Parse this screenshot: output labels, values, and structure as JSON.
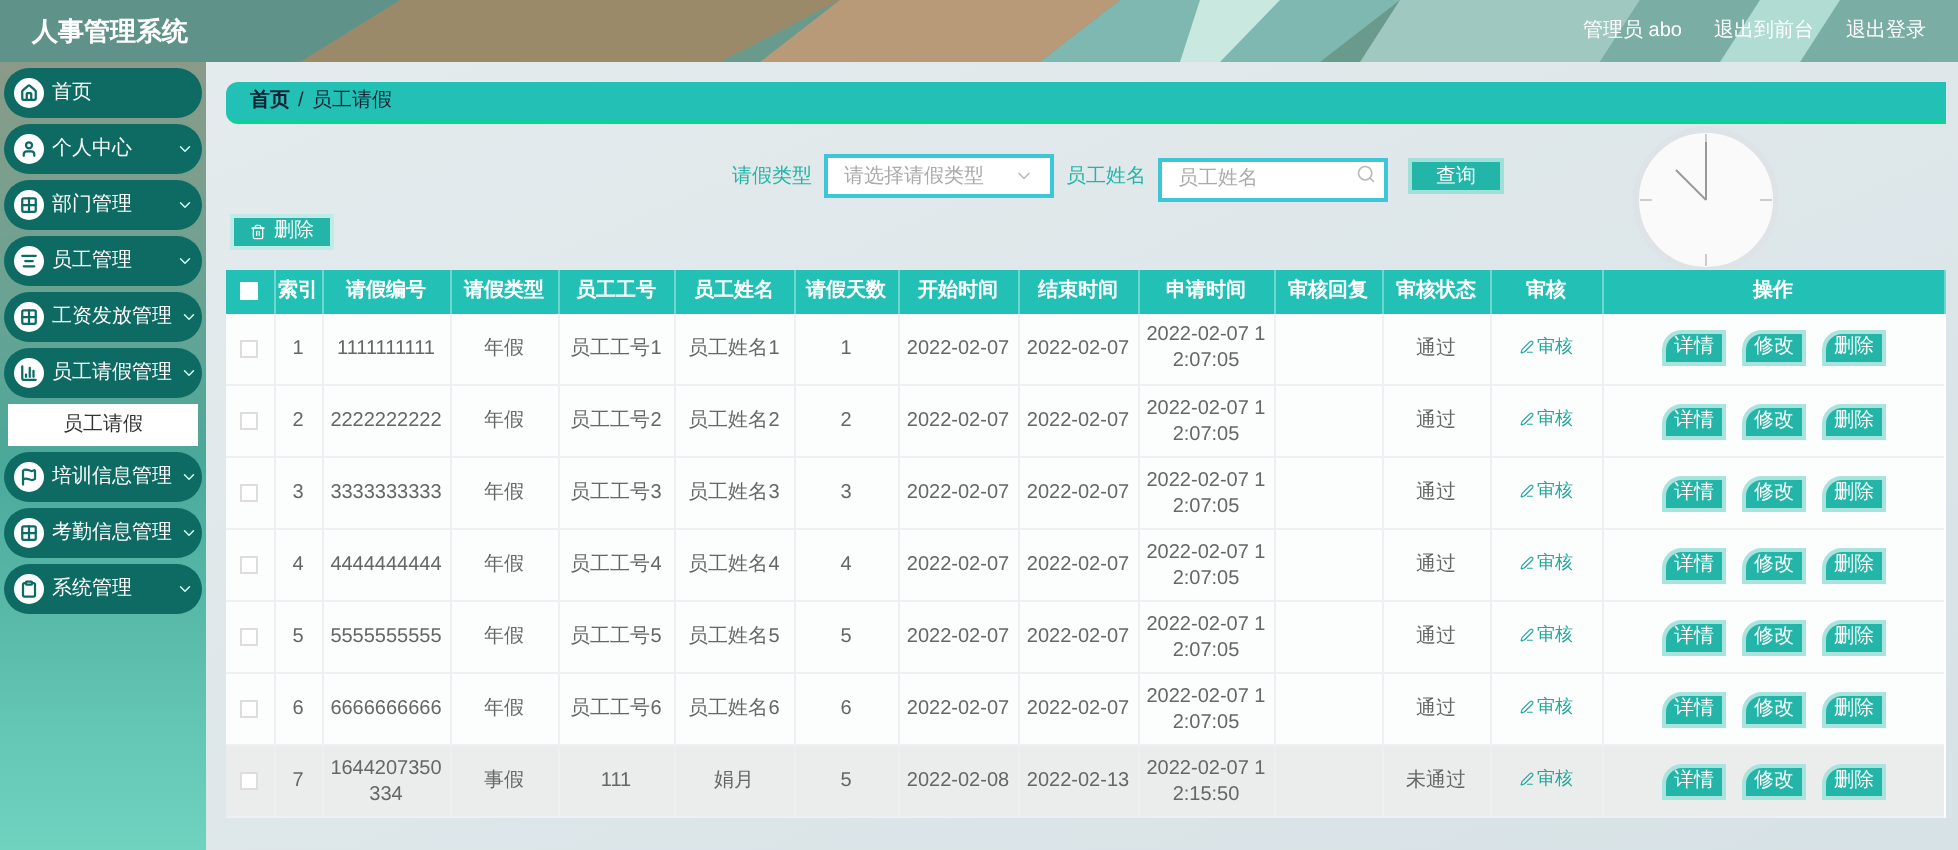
{
  "header": {
    "title": "人事管理系统",
    "links": [
      "管理员 abo",
      "退出到前台",
      "退出登录"
    ]
  },
  "sidebar": {
    "items": [
      {
        "label": "首页",
        "has_arrow": false
      },
      {
        "label": "个人中心",
        "has_arrow": true
      },
      {
        "label": "部门管理",
        "has_arrow": true
      },
      {
        "label": "员工管理",
        "has_arrow": true
      },
      {
        "label": "工资发放管理",
        "has_arrow": true
      },
      {
        "label": "员工请假管理",
        "has_arrow": true,
        "children": [
          {
            "label": "员工请假",
            "selected": true
          }
        ]
      },
      {
        "label": "培训信息管理",
        "has_arrow": true
      },
      {
        "label": "考勤信息管理",
        "has_arrow": true
      },
      {
        "label": "系统管理",
        "has_arrow": true
      }
    ]
  },
  "breadcrumb": [
    "首页",
    "/",
    "员工请假"
  ],
  "search": {
    "type_label": "请假类型",
    "type_placeholder": "请选择请假类型",
    "name_label": "员工姓名",
    "name_placeholder": "员工姓名",
    "button": "查询"
  },
  "delete_button": "删除",
  "table": {
    "select_all_checked": false,
    "columns": [
      "索引",
      "请假编号",
      "请假类型",
      "员工工号",
      "员工姓名",
      "请假天数",
      "开始时间",
      "结束时间",
      "申请时间",
      "审核回复",
      "审核状态",
      "审核",
      "操作"
    ],
    "rows": [
      {
        "checked": false,
        "highlighted": false,
        "cells": [
          "1",
          "1111111111",
          "年假",
          "员工工号1",
          "员工姓名1",
          "1",
          "2022-02-07",
          "2022-02-07",
          "2022-02-07 12:07:05",
          "",
          "通过"
        ],
        "review": "审核",
        "actions": [
          "详情",
          "修改",
          "删除"
        ]
      },
      {
        "checked": false,
        "highlighted": false,
        "cells": [
          "2",
          "2222222222",
          "年假",
          "员工工号2",
          "员工姓名2",
          "2",
          "2022-02-07",
          "2022-02-07",
          "2022-02-07 12:07:05",
          "",
          "通过"
        ],
        "review": "审核",
        "actions": [
          "详情",
          "修改",
          "删除"
        ]
      },
      {
        "checked": false,
        "highlighted": false,
        "cells": [
          "3",
          "3333333333",
          "年假",
          "员工工号3",
          "员工姓名3",
          "3",
          "2022-02-07",
          "2022-02-07",
          "2022-02-07 12:07:05",
          "",
          "通过"
        ],
        "review": "审核",
        "actions": [
          "详情",
          "修改",
          "删除"
        ]
      },
      {
        "checked": false,
        "highlighted": false,
        "cells": [
          "4",
          "4444444444",
          "年假",
          "员工工号4",
          "员工姓名4",
          "4",
          "2022-02-07",
          "2022-02-07",
          "2022-02-07 12:07:05",
          "",
          "通过"
        ],
        "review": "审核",
        "actions": [
          "详情",
          "修改",
          "删除"
        ]
      },
      {
        "checked": false,
        "highlighted": false,
        "cells": [
          "5",
          "5555555555",
          "年假",
          "员工工号5",
          "员工姓名5",
          "5",
          "2022-02-07",
          "2022-02-07",
          "2022-02-07 12:07:05",
          "",
          "通过"
        ],
        "review": "审核",
        "actions": [
          "详情",
          "修改",
          "删除"
        ]
      },
      {
        "checked": false,
        "highlighted": false,
        "cells": [
          "6",
          "6666666666",
          "年假",
          "员工工号6",
          "员工姓名6",
          "6",
          "2022-02-07",
          "2022-02-07",
          "2022-02-07 12:07:05",
          "",
          "通过"
        ],
        "review": "审核",
        "actions": [
          "详情",
          "修改",
          "删除"
        ]
      },
      {
        "checked": false,
        "highlighted": true,
        "cells": [
          "7",
          "1644207350334",
          "事假",
          "111",
          "娟月",
          "5",
          "2022-02-08",
          "2022-02-13",
          "2022-02-07 12:15:50",
          "",
          "未通过"
        ],
        "review": "审核",
        "actions": [
          "详情",
          "修改",
          "删除"
        ]
      }
    ]
  }
}
